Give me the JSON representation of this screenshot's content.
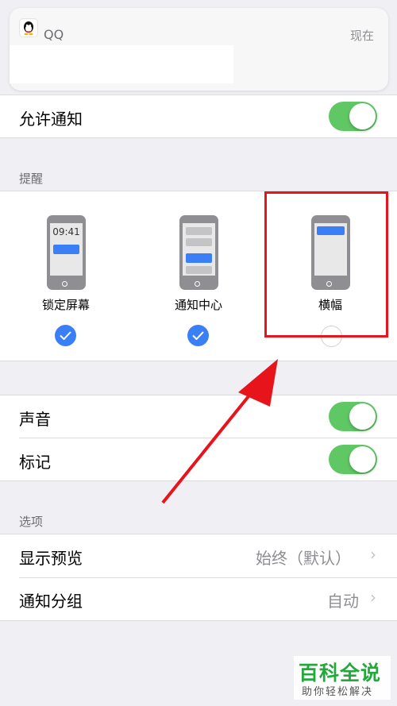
{
  "banner": {
    "app_name": "QQ",
    "time": "现在"
  },
  "allow_notifications": {
    "label": "允许通知",
    "enabled": true
  },
  "alerts": {
    "section_title": "提醒",
    "styles": [
      {
        "label": "锁定屏幕",
        "screen_time": "09:41",
        "selected": true
      },
      {
        "label": "通知中心",
        "selected": true
      },
      {
        "label": "横幅",
        "selected": false
      }
    ]
  },
  "sound": {
    "label": "声音",
    "enabled": true
  },
  "badges": {
    "label": "标记",
    "enabled": true
  },
  "options": {
    "section_title": "选项",
    "show_previews": {
      "label": "显示预览",
      "value": "始终（默认）"
    },
    "grouping": {
      "label": "通知分组",
      "value": "自动"
    }
  },
  "watermark": {
    "title": "百科全说",
    "subtitle": "助你轻松解决"
  },
  "colors": {
    "toggle_on": "#5fc864",
    "accent_blue": "#3a7ff6",
    "annotation_red": "#e8141c",
    "watermark_green": "#24a83b"
  }
}
